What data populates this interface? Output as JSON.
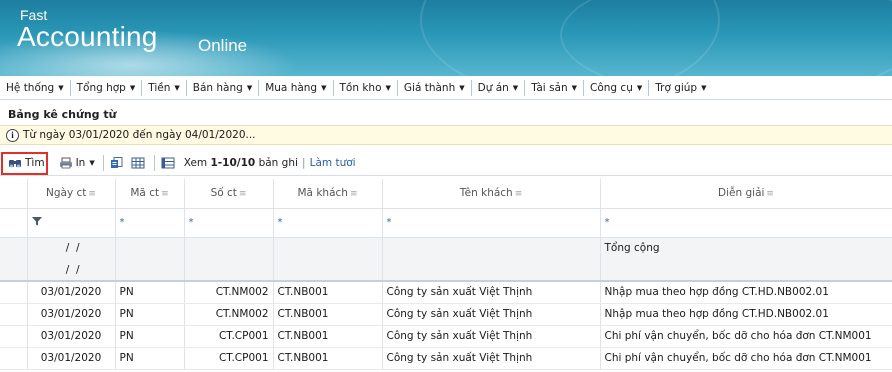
{
  "brand": {
    "top": "Fast",
    "main": "Accounting",
    "suffix": "Online"
  },
  "menu": [
    "Hệ thống",
    "Tổng hợp",
    "Tiền",
    "Bán hàng",
    "Mua hàng",
    "Tồn kho",
    "Giá thành",
    "Dự án",
    "Tài sản",
    "Công cụ",
    "Trợ giúp"
  ],
  "page": {
    "title": "Bảng kê chứng từ",
    "info": "Từ ngày 03/01/2020 đến ngày 04/01/2020..."
  },
  "toolbar": {
    "find": "Tìm",
    "print": "In",
    "view_prefix": "Xem",
    "view_range": "1-10/10",
    "view_suffix": "bản ghi",
    "refresh": "Làm tươi"
  },
  "grid": {
    "columns": [
      "Ngày ct",
      "Mã ct",
      "Số ct",
      "Mã khách",
      "Tên khách",
      "Diễn giải"
    ],
    "filter_marker": "*",
    "summary": {
      "date1": " /  /",
      "date2": " /  /",
      "total_label": "Tổng cộng"
    },
    "rows": [
      {
        "date": "03/01/2020",
        "code": "PN",
        "number": "CT.NM002",
        "cust_code": "CT.NB001",
        "cust_name": "Công ty sản xuất Việt Thịnh",
        "desc": "Nhập mua theo hợp đồng CT.HD.NB002.01"
      },
      {
        "date": "03/01/2020",
        "code": "PN",
        "number": "CT.NM002",
        "cust_code": "CT.NB001",
        "cust_name": "Công ty sản xuất Việt Thịnh",
        "desc": "Nhập mua theo hợp đồng CT.HD.NB002.01"
      },
      {
        "date": "03/01/2020",
        "code": "PN",
        "number": "CT.CP001",
        "cust_code": "CT.NB001",
        "cust_name": "Công ty sản xuất Việt Thịnh",
        "desc": "Chi phí vận chuyển, bốc dỡ cho hóa đơn CT.NM001"
      },
      {
        "date": "03/01/2020",
        "code": "PN",
        "number": "CT.CP001",
        "cust_code": "CT.NB001",
        "cust_name": "Công ty sản xuất Việt Thịnh",
        "desc": "Chi phí vận chuyển, bốc dỡ cho hóa đơn CT.NM001"
      }
    ]
  }
}
